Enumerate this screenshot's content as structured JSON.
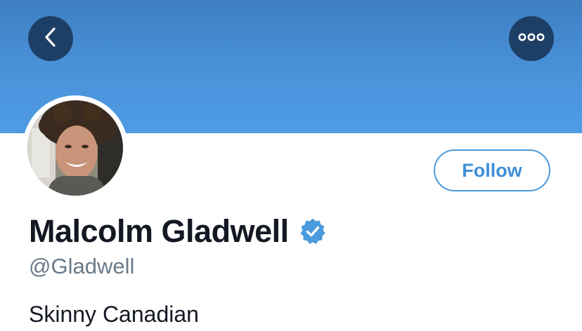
{
  "header": {
    "back_icon": "chevron-left-icon",
    "more_icon": "more-horizontal-icon",
    "banner_color": "#4a94dc",
    "button_color": "#1d3f66"
  },
  "profile": {
    "display_name": "Malcolm Gladwell",
    "verified": true,
    "verified_icon": "verified-badge-icon",
    "handle": "@Gladwell",
    "bio": "Skinny Canadian",
    "follow_label": "Follow",
    "accent_color": "#4a9ade"
  }
}
